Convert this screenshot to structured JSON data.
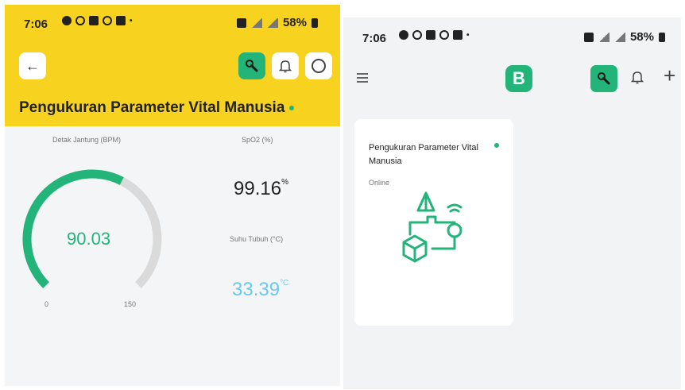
{
  "colors": {
    "yellow_header": "#f7d21e",
    "brand_green": "#23b47a",
    "gauge_track": "#dadada",
    "temp_blue": "#6cc9ee",
    "app_bg": "#f1f3f5"
  },
  "status_bar": {
    "time": "7:06",
    "battery": "58%"
  },
  "left_screen": {
    "header_icons": [
      "back-arrow-icon",
      "wrench-icon",
      "bell-icon",
      "circle-icon"
    ],
    "title": "Pengukuran Parameter Vital Manusia",
    "heart_rate": {
      "label": "Detak Jantung (BPM)",
      "value": "90.03",
      "value_num": 90.03,
      "min": "0",
      "max": "150",
      "max_num": 150
    },
    "spo2": {
      "label": "SpO2 (%)",
      "value": "99.16",
      "unit": "%"
    },
    "body_temp": {
      "label": "Suhu Tubuh (°C)",
      "value": "33.39",
      "unit": "°C"
    }
  },
  "right_screen": {
    "logo_letter": "B",
    "header_icons": [
      "menu-icon",
      "wrench-icon",
      "bell-icon",
      "plus-icon"
    ],
    "device_card": {
      "title": "Pengukuran Parameter Vital Manusia",
      "status": "Online"
    }
  }
}
